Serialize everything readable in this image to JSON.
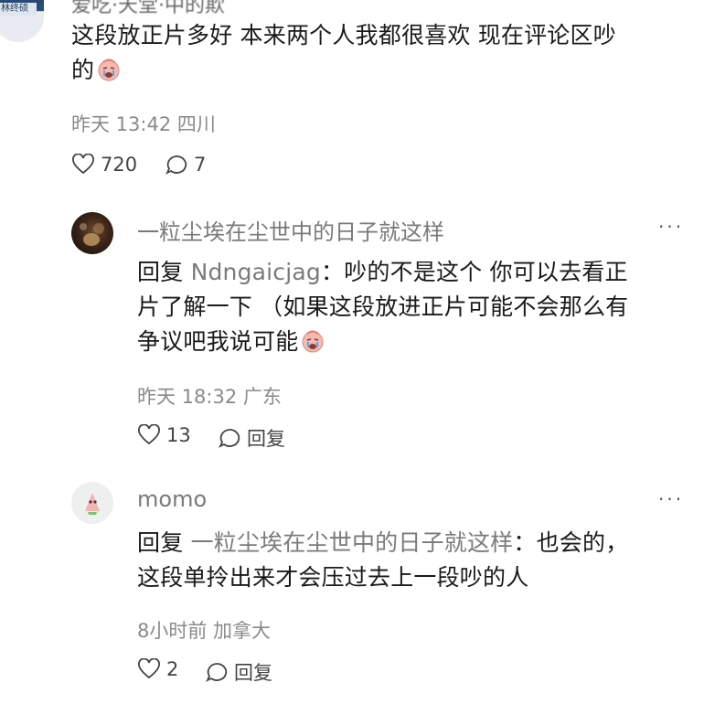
{
  "comment_main": {
    "username_cut": "爱吃·天堂·中的欺",
    "avatar_tag": "林终硕",
    "text_line1": "这段放正片多好 本来两个人我都很喜欢 现在评论区吵",
    "text_line2": "的",
    "emoji": "crying-face-emoji",
    "time": "昨天 13:42 四川",
    "likes": "720",
    "replies": "7"
  },
  "reply1": {
    "username": "一粒尘埃在尘世中的日子就这样",
    "more": "···",
    "reply_prefix": "回复 ",
    "mention": "Ndngaicjag",
    "text_line1": "：吵的不是这个 你可以去看正",
    "text_line2": "片了解一下  （如果这段放进正片可能不会那么有",
    "text_line3": "争议吧我说可能",
    "emoji": "crying-face-emoji",
    "time": "昨天 18:32 广东",
    "likes": "13",
    "reply_label": "回复"
  },
  "reply2": {
    "username": "momo",
    "more": "···",
    "reply_prefix": "回复 ",
    "mention": "一粒尘埃在尘世中的日子就这样",
    "text_line1": "：也会的，",
    "text_line2": "这段单拎出来才会压过去上一段吵的人",
    "time": "8小时前 加拿大",
    "likes": "2",
    "reply_label": "回复"
  },
  "colors": {
    "text": "#1a1a1a",
    "meta": "#8a8a8a",
    "username": "#7a7a7a",
    "emoji_face": "#f6b9b0"
  }
}
